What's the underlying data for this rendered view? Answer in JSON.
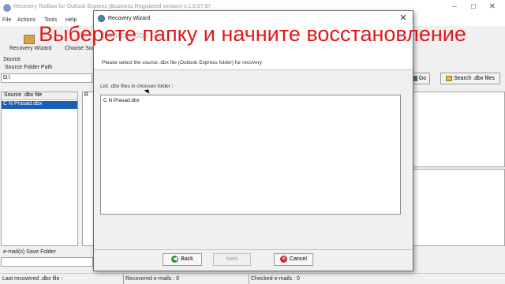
{
  "app": {
    "title": "Recovery Toolbox for Outlook Express (Business Registered version) v.1.0.57.97",
    "menu": [
      "File",
      "Actions",
      "Tools",
      "Help"
    ],
    "toolbar": {
      "recovery_wizard": "Recovery Wizard",
      "choose_source": "Choose Sou"
    },
    "source_group": "Source",
    "source_folder_path_label": "Source Folder Path",
    "source_path_value": "D:\\",
    "go_button": "Go",
    "search_button": "Search .dbx files",
    "source_dbx_header": "Source .dbx file",
    "source_dbx_item": "C N Prasad.dbx",
    "r_header": "R",
    "emails_save_folder": "e-mail(s) Save Folder",
    "status": {
      "last_recovered": "Last recovered .dbx file :",
      "recovered_emails": "Recovered e-mails : 0",
      "checked_emails": "Checked e-mails : 0"
    }
  },
  "dialog": {
    "title": "Recovery Wizard",
    "header_ghost": "Source .dbx file",
    "instruction": "Please select the source .dbx file (Outlook Express folder) for recovery",
    "list_label": "List .dbx files in choosen folder :",
    "files": [
      "C N Prasad.dbx"
    ],
    "back_button": "Back",
    "next_button": "Next",
    "cancel_button": "Cancel"
  },
  "overlay": {
    "caption": "Выберете папку и начните восстановление"
  },
  "colors": {
    "caption": "#e01818",
    "selection": "#1a5fb4"
  }
}
